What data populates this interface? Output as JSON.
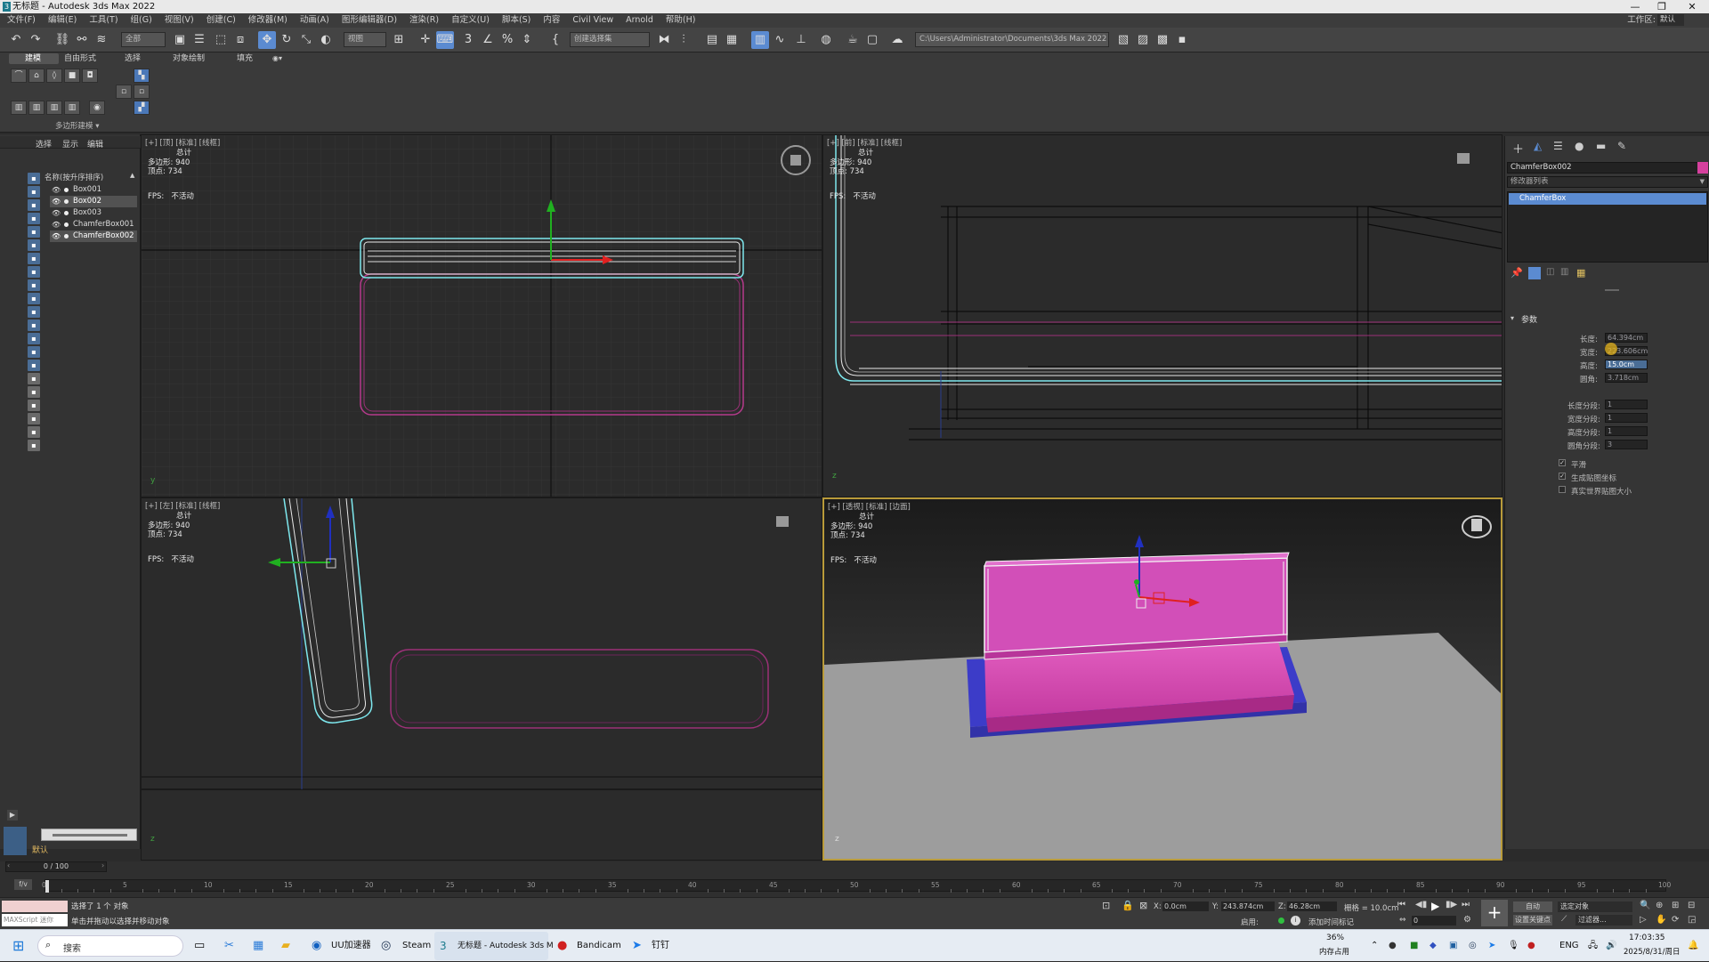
{
  "window": {
    "title": "无标题 - Autodesk 3ds Max 2022",
    "min": "—",
    "max": "❐",
    "close": "✕"
  },
  "menu": {
    "items": [
      "文件(F)",
      "编辑(E)",
      "工具(T)",
      "组(G)",
      "视图(V)",
      "创建(C)",
      "修改器(M)",
      "动画(A)",
      "图形编辑器(D)",
      "渲染(R)",
      "自定义(U)",
      "脚本(S)",
      "内容",
      "Civil View",
      "Arnold",
      "帮助(H)"
    ],
    "workspace_label": "工作区:",
    "workspace_value": "默认"
  },
  "toolbar": {
    "selection_filter": "全部",
    "ref_coord": "视图",
    "named_sel": "创建选择集",
    "project_path": "C:\\Users\\Administrator\\Documents\\3ds Max 2022"
  },
  "ribbon": {
    "tabs": [
      "建模",
      "自由形式",
      "选择",
      "对象绘制",
      "填充"
    ],
    "group_label": "多边形建模 ▾"
  },
  "scene_explorer": {
    "tabs": [
      "选择",
      "显示",
      "编辑"
    ],
    "column_header": "名称(按升序排序)",
    "objects": [
      "Box001",
      "Box002",
      "Box003",
      "ChamferBox001",
      "ChamferBox002"
    ],
    "layer": "默认"
  },
  "viewports": [
    {
      "id": "top",
      "label": "[+] [顶] [标准] [线框]",
      "total": "总计",
      "poly_label": "多边形:",
      "poly": "940",
      "vert_label": "顶点:",
      "vert": "734",
      "fps_label": "FPS:",
      "fps": "不活动"
    },
    {
      "id": "front",
      "label": "[+] [前] [标准] [线框]",
      "total": "总计",
      "poly_label": "多边形:",
      "poly": "940",
      "vert_label": "顶点:",
      "vert": "734",
      "fps_label": "FPS:",
      "fps": "不活动"
    },
    {
      "id": "left",
      "label": "[+] [左] [标准] [线框]",
      "total": "总计",
      "poly_label": "多边形:",
      "poly": "940",
      "vert_label": "顶点:",
      "vert": "734",
      "fps_label": "FPS:",
      "fps": "不活动"
    },
    {
      "id": "persp",
      "label": "[+] [透视] [标准] [边面]",
      "total": "总计",
      "poly_label": "多边形:",
      "poly": "940",
      "vert_label": "顶点:",
      "vert": "734",
      "fps_label": "FPS:",
      "fps": "不活动"
    }
  ],
  "command_panel": {
    "object_name": "ChamferBox002",
    "modifier_list": "修改器列表",
    "stack_item": "ChamferBox",
    "rollout": "参数",
    "params": [
      {
        "label": "长度:",
        "value": "64.394cm"
      },
      {
        "label": "宽度:",
        "value": "223.606cm"
      },
      {
        "label": "高度:",
        "value": "15.0cm"
      },
      {
        "label": "圆角:",
        "value": "3.718cm"
      }
    ],
    "segments": [
      {
        "label": "长度分段:",
        "value": "1"
      },
      {
        "label": "宽度分段:",
        "value": "1"
      },
      {
        "label": "高度分段:",
        "value": "1"
      },
      {
        "label": "圆角分段:",
        "value": "3"
      }
    ],
    "checks": [
      {
        "label": "平滑",
        "checked": true
      },
      {
        "label": "生成贴图坐标",
        "checked": true
      },
      {
        "label": "真实世界贴图大小",
        "checked": false
      }
    ],
    "colors": {
      "object_color": "#d6409e"
    }
  },
  "timeline": {
    "frame": "0 / 100",
    "ticks": [
      "0",
      "5",
      "10",
      "15",
      "20",
      "25",
      "30",
      "35",
      "40",
      "45",
      "50",
      "55",
      "60",
      "65",
      "70",
      "75",
      "80",
      "85",
      "90",
      "95",
      "100"
    ]
  },
  "status": {
    "selected": "选择了 1 个 对象",
    "prompt": "单击并拖动以选择并移动对象",
    "maxscript": "MAXScript 迷你",
    "x_label": "X:",
    "x": "0.0cm",
    "y_label": "Y:",
    "y": "243.874cm",
    "z_label": "Z:",
    "z": "46.28cm",
    "grid": "栅格 = 10.0cm",
    "auto": "自动",
    "set_key": "设置关键点",
    "sel_obj": "选定对象",
    "key_filter": "过滤器...",
    "enabled": "启用:",
    "add_tag": "添加时间标记",
    "frame_num": "0"
  },
  "taskbar": {
    "search": "搜索",
    "apps": [
      "UU加速器",
      "Steam",
      "无标题 - Autodesk 3ds M",
      "Bandicam",
      "钉钉"
    ],
    "mem_pct": "36%",
    "mem_label": "内存占用",
    "lang": "ENG",
    "time": "17:03:35",
    "date": "2025/8/31/周日"
  },
  "colors": {
    "accent": "#5b8bd1",
    "viewport_active": "#b99b3a",
    "magenta": "#d6409e",
    "cyan_select": "#7ee8ee"
  }
}
